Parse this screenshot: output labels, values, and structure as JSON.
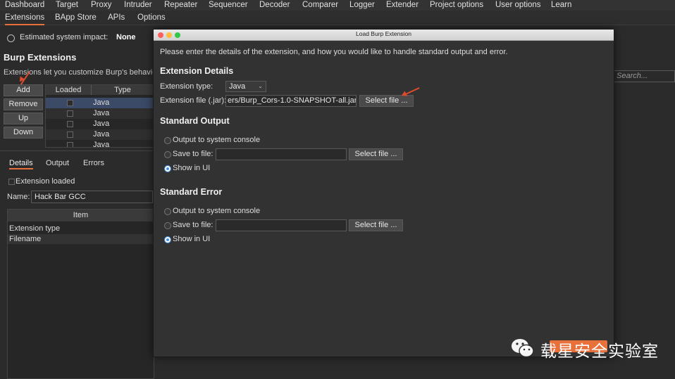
{
  "topnav": [
    "Dashboard",
    "Target",
    "Proxy",
    "Intruder",
    "Repeater",
    "Sequencer",
    "Decoder",
    "Comparer",
    "Logger",
    "Extender",
    "Project options",
    "User options",
    "Learn"
  ],
  "subnav": [
    "Extensions",
    "BApp Store",
    "APIs",
    "Options"
  ],
  "impact": {
    "label": "Estimated system impact:",
    "value": "None"
  },
  "section": {
    "title": "Burp Extensions",
    "desc": "Extensions let you customize Burp's behavio"
  },
  "buttons": {
    "add": "Add",
    "remove": "Remove",
    "up": "Up",
    "down": "Down"
  },
  "ext_table": {
    "headers": [
      "Loaded",
      "Type"
    ],
    "rows": [
      "Java",
      "Java",
      "Java",
      "Java",
      "Java"
    ]
  },
  "search_placeholder": "Search...",
  "detail_tabs": [
    "Details",
    "Output",
    "Errors"
  ],
  "details": {
    "loaded_label": "Extension loaded",
    "name_label": "Name:",
    "name_value": "Hack Bar GCC",
    "item_header": "Item",
    "items": [
      "Extension type",
      "Filename"
    ]
  },
  "dialog": {
    "title": "Load Burp Extension",
    "intro": "Please enter the details of the extension, and how you would like to handle standard output and error.",
    "ext_details": "Extension Details",
    "type_label": "Extension type:",
    "type_value": "Java",
    "file_label": "Extension file (.jar):",
    "file_value": "ers/Burp_Cors-1.0-SNAPSHOT-all.jar",
    "select_file": "Select file ...",
    "std_out": "Standard Output",
    "std_err": "Standard Error",
    "opt_console": "Output to system console",
    "opt_save": "Save to file:",
    "opt_ui": "Show in UI"
  },
  "watermark": "载星安全实验室",
  "colors": {
    "accent": "#e8703a",
    "radio_selected": "#4a90e2",
    "arrow": "#e04b2e"
  }
}
